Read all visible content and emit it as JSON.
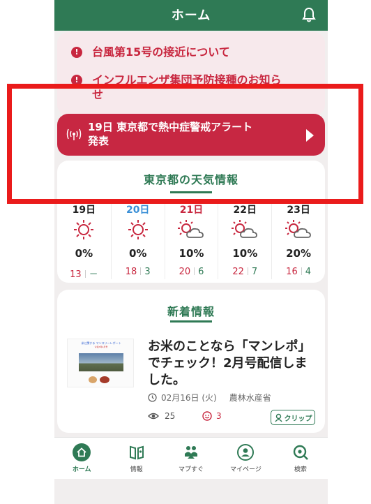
{
  "header": {
    "title": "ホーム"
  },
  "notices": [
    {
      "text": "台風第15号の接近について"
    },
    {
      "text": "インフルエンザ集団予防接種のお知ら\nせ"
    }
  ],
  "alert_banner": {
    "text": "19日 東京都で熱中症警戒アラート\n発表"
  },
  "weather": {
    "title": "東京都の天気情報",
    "days": [
      {
        "label": "19日",
        "icon": "sun-icon",
        "precip": "0%",
        "high": "13",
        "low": "－"
      },
      {
        "label": "20日",
        "icon": "sun-icon",
        "precip": "0%",
        "high": "18",
        "low": "3"
      },
      {
        "label": "21日",
        "icon": "sun-cloud-icon",
        "precip": "10%",
        "high": "20",
        "low": "6"
      },
      {
        "label": "22日",
        "icon": "sun-cloud-icon",
        "precip": "10%",
        "high": "22",
        "low": "7"
      },
      {
        "label": "23日",
        "icon": "sun-cloud-icon",
        "precip": "20%",
        "high": "16",
        "low": "4"
      }
    ],
    "colors": {
      "day19": "#222222",
      "day20": "#3a8fd6",
      "day21": "#c8273f",
      "day22": "#222222",
      "day23": "#222222"
    }
  },
  "news": {
    "title": "新着情報",
    "article": {
      "title": "お米のことなら「マンレポ」でチェック！2月号配信しました。",
      "date": "02月16日 (火)",
      "source": "農林水産省",
      "views": "25",
      "likes": "3",
      "clip_label": "クリップ",
      "thumb_title": "米に関する マンスリーレポート",
      "thumb_sub": "令和3年2月号"
    }
  },
  "tabbar": [
    {
      "label": "ホーム",
      "icon": "home-icon",
      "active": true
    },
    {
      "label": "情報",
      "icon": "map-book-icon"
    },
    {
      "label": "マプすぐ",
      "icon": "people-icon"
    },
    {
      "label": "マイページ",
      "icon": "user-icon"
    },
    {
      "label": "検索",
      "icon": "search-icon"
    }
  ],
  "accent_colors": {
    "primary": "#2f7a55",
    "alert": "#c72742",
    "highlight": "#ea1b1b"
  }
}
